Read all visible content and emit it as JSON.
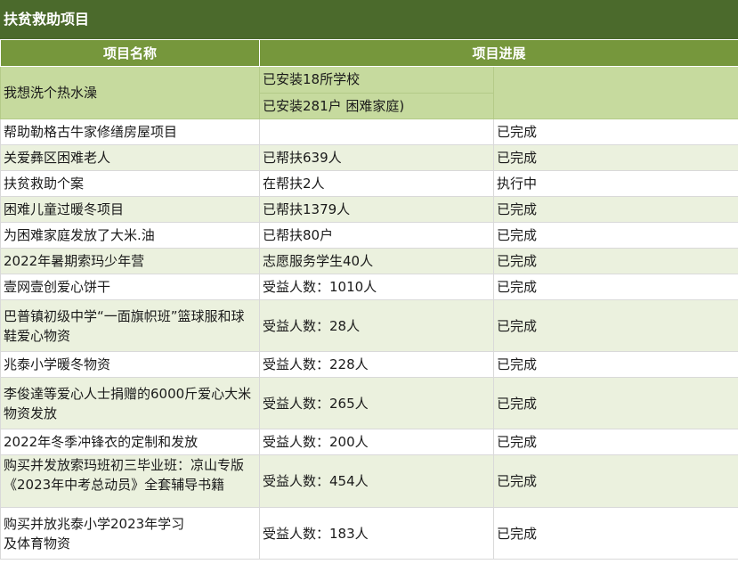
{
  "title": "扶贫救助项目",
  "headers": {
    "name": "项目名称",
    "progress": "项目进展"
  },
  "first_row": {
    "name": "我想洗个热水澡",
    "progress_a": "已安装18所学校",
    "progress_b": "已安装281户 困难家庭)",
    "status": ""
  },
  "rows": [
    {
      "name": "帮助勒格古牛家修缮房屋项目",
      "progress": "",
      "status": "已完成"
    },
    {
      "name": "关爱彝区困难老人",
      "progress": "已帮扶639人",
      "status": "已完成"
    },
    {
      "name": "扶贫救助个案",
      "progress": "在帮扶2人",
      "status": "执行中"
    },
    {
      "name": "困难儿童过暖冬项目",
      "progress": "已帮扶1379人",
      "status": "已完成"
    },
    {
      "name": "为困难家庭发放了大米.油",
      "progress": "已帮扶80户",
      "status": "已完成"
    },
    {
      "name": "2022年暑期索玛少年营",
      "progress": "志愿服务学生40人",
      "status": "已完成"
    },
    {
      "name": "壹网壹创爱心饼干",
      "progress": "受益人数：1010人",
      "status": "已完成"
    },
    {
      "name": "巴普镇初级中学“一面旗帜班”篮球服和球鞋爱心物资",
      "progress": "受益人数：28人",
      "status": "已完成"
    },
    {
      "name": "兆泰小学暖冬物资",
      "progress": "受益人数：228人",
      "status": "已完成"
    },
    {
      "name": "李俊達等爱心人士捐赠的6000斤爱心大米物资发放",
      "progress": "受益人数：265人",
      "status": "已完成"
    },
    {
      "name": "2022年冬季冲锋衣的定制和发放",
      "progress": "受益人数：200人",
      "status": "已完成"
    },
    {
      "name": "购买并发放索玛班初三毕业班：凉山专版《2023年中考总动员》全套辅导书籍",
      "progress": "受益人数：454人",
      "status": "已完成"
    },
    {
      "name": "购买并放兆泰小学2023年学习\n及体育物资",
      "progress": "受益人数：183人",
      "status": "已完成"
    }
  ]
}
